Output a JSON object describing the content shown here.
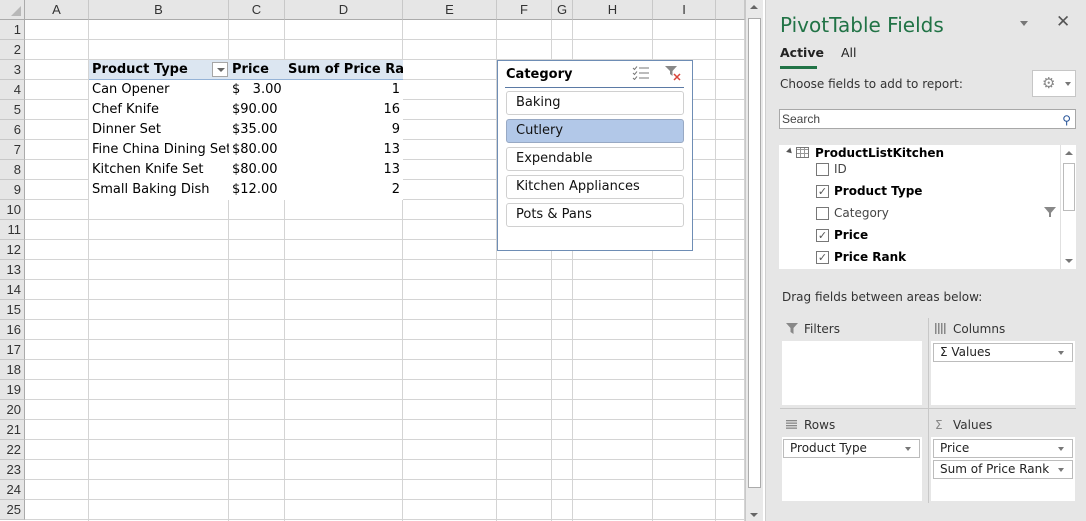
{
  "sheet": {
    "columns": [
      "A",
      "B",
      "C",
      "D",
      "E",
      "F",
      "G",
      "H",
      "I"
    ],
    "rows": [
      "1",
      "2",
      "3",
      "4",
      "5",
      "6",
      "7",
      "8",
      "9",
      "10",
      "11",
      "12",
      "13",
      "14",
      "15",
      "16",
      "17",
      "18",
      "19",
      "20",
      "21",
      "22",
      "23",
      "24",
      "25"
    ],
    "pivot": {
      "headers": {
        "product_type": "Product Type",
        "price": "Price",
        "rank": "Sum of Price Rank"
      },
      "rows": [
        {
          "product": "Can Opener",
          "price": "$   3.00",
          "rank": "1"
        },
        {
          "product": "Chef Knife",
          "price": "$90.00",
          "rank": "16"
        },
        {
          "product": "Dinner Set",
          "price": "$35.00",
          "rank": "9"
        },
        {
          "product": "Fine China Dining Set",
          "price": "$80.00",
          "rank": "13"
        },
        {
          "product": "Kitchen Knife Set",
          "price": "$80.00",
          "rank": "13"
        },
        {
          "product": "Small Baking Dish",
          "price": "$12.00",
          "rank": "2"
        }
      ]
    }
  },
  "slicer": {
    "title": "Category",
    "items": [
      {
        "label": "Baking",
        "selected": false
      },
      {
        "label": "Cutlery",
        "selected": true
      },
      {
        "label": "Expendable",
        "selected": false
      },
      {
        "label": "Kitchen Appliances",
        "selected": false
      },
      {
        "label": "Pots & Pans",
        "selected": false
      }
    ]
  },
  "pane": {
    "title": "PivotTable Fields",
    "tabs": [
      {
        "label": "Active"
      },
      {
        "label": "All"
      }
    ],
    "choose_label": "Choose fields to add to report:",
    "search_placeholder": "Search",
    "table_name": "ProductListKitchen",
    "fields": [
      {
        "label": "ID",
        "checked": false,
        "bold": false,
        "filtered": false
      },
      {
        "label": "Product Type",
        "checked": true,
        "bold": true,
        "filtered": false
      },
      {
        "label": "Category",
        "checked": false,
        "bold": false,
        "filtered": true
      },
      {
        "label": "Price",
        "checked": true,
        "bold": true,
        "filtered": false
      },
      {
        "label": "Price Rank",
        "checked": true,
        "bold": true,
        "filtered": false
      }
    ],
    "drag_label": "Drag fields between areas below:",
    "areas": {
      "filters": {
        "label": "Filters",
        "items": []
      },
      "columns": {
        "label": "Columns",
        "items": [
          "Σ Values"
        ]
      },
      "rows": {
        "label": "Rows",
        "items": [
          "Product Type"
        ]
      },
      "values": {
        "label": "Values",
        "items": [
          "Price",
          "Sum of Price Rank"
        ]
      }
    }
  },
  "colors": {
    "accent": "#217346",
    "slicer_selected": "#b2c8e8",
    "pivot_header": "#dce6f1"
  }
}
